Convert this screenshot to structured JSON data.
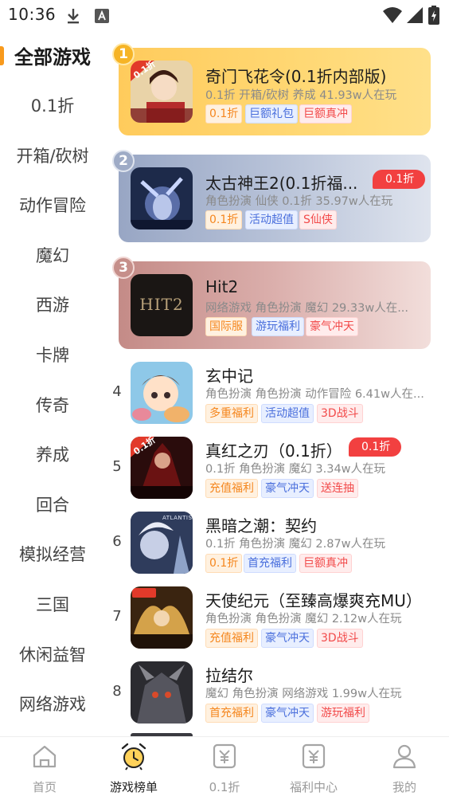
{
  "status_bar": {
    "time": "10:36"
  },
  "sidebar": {
    "items": [
      {
        "label": "全部游戏",
        "active": true
      },
      {
        "label": "0.1折"
      },
      {
        "label": "开箱/砍树"
      },
      {
        "label": "动作冒险"
      },
      {
        "label": "魔幻"
      },
      {
        "label": "西游"
      },
      {
        "label": "卡牌"
      },
      {
        "label": "传奇"
      },
      {
        "label": "养成"
      },
      {
        "label": "回合"
      },
      {
        "label": "模拟经营"
      },
      {
        "label": "三国"
      },
      {
        "label": "休闲益智"
      },
      {
        "label": "网络游戏"
      }
    ]
  },
  "games": [
    {
      "rank": "1",
      "title": "奇门飞花令(0.1折内部版)",
      "meta": "0.1折 开箱/砍树 养成  41.93w人在玩",
      "tags": [
        "0.1折",
        "巨额礼包",
        "巨额真冲"
      ],
      "thumb_badge": "0.1折"
    },
    {
      "rank": "2",
      "title": "太古神王2(0.1折福...",
      "meta": "角色扮演 仙侠 0.1折  35.97w人在玩",
      "tags": [
        "0.1折",
        "活动超值",
        "S仙侠"
      ],
      "discount": "0.1折"
    },
    {
      "rank": "3",
      "title": "Hit2",
      "meta": "网络游戏 角色扮演 魔幻  29.33w人在...",
      "tags": [
        "国际服",
        "游玩福利",
        "豪气冲天"
      ],
      "thumb_text": "HIT2"
    },
    {
      "rank": "4",
      "title": "玄中记",
      "meta": "角色扮演 角色扮演 动作冒险  6.41w人在...",
      "tags": [
        "多重福利",
        "活动超值",
        "3D战斗"
      ]
    },
    {
      "rank": "5",
      "title": "真红之刃（0.1折）",
      "meta": "0.1折 角色扮演 魔幻  3.34w人在玩",
      "tags": [
        "充值福利",
        "豪气冲天",
        "送连抽"
      ],
      "discount": "0.1折",
      "thumb_badge": "0.1折"
    },
    {
      "rank": "6",
      "title": "黑暗之潮：契约",
      "meta": "0.1折 角色扮演 魔幻  2.87w人在玩",
      "tags": [
        "0.1折",
        "首充福利",
        "巨额真冲"
      ],
      "thumb_text": "ATLANTIS"
    },
    {
      "rank": "7",
      "title": "天使纪元（至臻高爆爽充MU）",
      "meta": "角色扮演 角色扮演 魔幻  2.12w人在玩",
      "tags": [
        "充值福利",
        "豪气冲天",
        "3D战斗"
      ]
    },
    {
      "rank": "8",
      "title": "拉结尔",
      "meta": "魔幻 角色扮演 网络游戏  1.99w人在玩",
      "tags": [
        "首充福利",
        "豪气冲天",
        "游玩福利"
      ]
    }
  ],
  "bottom_nav": [
    {
      "label": "首页",
      "icon": "home-icon"
    },
    {
      "label": "游戏榜单",
      "icon": "alarm-clock-icon",
      "active": true
    },
    {
      "label": "0.1折",
      "icon": "yuan-doc-icon"
    },
    {
      "label": "福利中心",
      "icon": "yuan-doc-icon"
    },
    {
      "label": "我的",
      "icon": "person-icon"
    }
  ],
  "colors": {
    "accent": "#f89a1c",
    "discount": "#f24040",
    "tag_orange": "#f5871f",
    "tag_blue": "#4a6fdc",
    "tag_red": "#f24a4a"
  }
}
